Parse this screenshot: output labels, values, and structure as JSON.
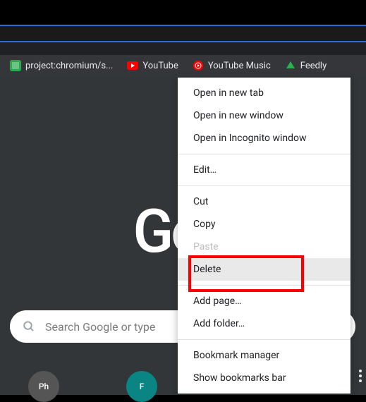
{
  "bookmarks": [
    {
      "label": "project:chromium/s...",
      "icon": "green-square"
    },
    {
      "label": "YouTube",
      "icon": "youtube"
    },
    {
      "label": "YouTube Music",
      "icon": "youtube-music"
    },
    {
      "label": "Feedly",
      "icon": "feedly"
    }
  ],
  "logo_text": "Goo",
  "search": {
    "placeholder": "Search Google or type"
  },
  "context_menu": {
    "open_new_tab": "Open in new tab",
    "open_new_window": "Open in new window",
    "open_incognito": "Open in Incognito window",
    "edit": "Edit…",
    "cut": "Cut",
    "copy": "Copy",
    "paste": "Paste",
    "delete": "Delete",
    "add_page": "Add page…",
    "add_folder": "Add folder…",
    "bookmark_manager": "Bookmark manager",
    "show_bookmarks_bar": "Show bookmarks bar"
  },
  "app_shortcuts": [
    {
      "label": "Ph"
    },
    {
      "label": "F"
    }
  ]
}
